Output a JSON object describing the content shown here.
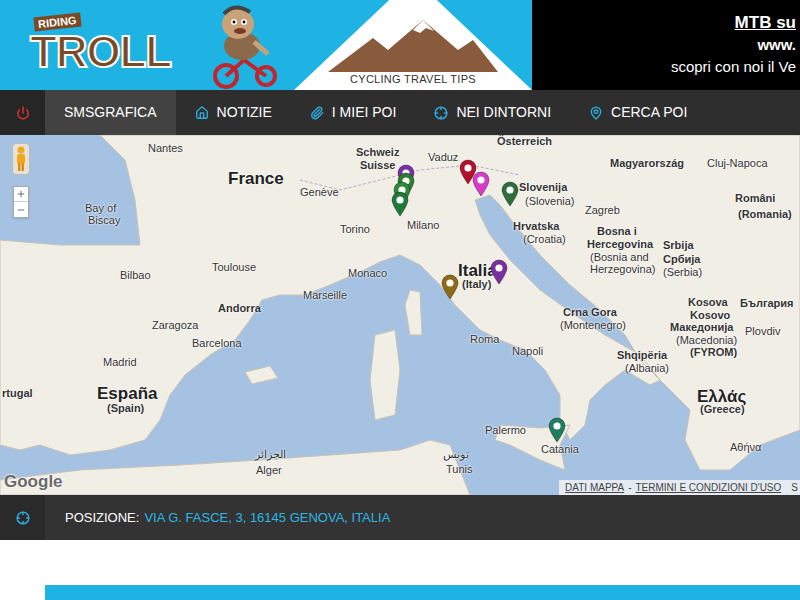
{
  "header": {
    "logo": {
      "top": "RIDING",
      "main": "TROLL"
    },
    "tagline": "CYCLING TRAVEL TIPS",
    "promo": [
      "MTB su",
      "www.",
      "scopri con noi il Ve"
    ]
  },
  "nav": {
    "items": [
      {
        "label": "",
        "selected": false
      },
      {
        "label": "SMSGRAFICA",
        "selected": true
      },
      {
        "label": "NOTIZIE",
        "selected": false
      },
      {
        "label": "I MIEI POI",
        "selected": false
      },
      {
        "label": "NEI DINTORNI",
        "selected": false
      },
      {
        "label": "CERCA POI",
        "selected": false
      }
    ]
  },
  "map": {
    "labels": [
      {
        "text": "France",
        "kind": "country"
      },
      {
        "text": "España",
        "kind": "country"
      },
      {
        "text": "(Spain)",
        "kind": "region"
      },
      {
        "text": "Italia",
        "kind": "country"
      },
      {
        "text": "(Italy)",
        "kind": "region"
      },
      {
        "text": "Bay of",
        "kind": "city"
      },
      {
        "text": "Biscay",
        "kind": "city"
      },
      {
        "text": "Nantes",
        "kind": "city"
      },
      {
        "text": "Genève",
        "kind": "city"
      },
      {
        "text": "Schweiz",
        "kind": "region"
      },
      {
        "text": "Suisse",
        "kind": "region"
      },
      {
        "text": "Vaduz",
        "kind": "city"
      },
      {
        "text": "Österreich",
        "kind": "region"
      },
      {
        "text": "Magyarország",
        "kind": "region"
      },
      {
        "text": "Cluj-Napoca",
        "kind": "city"
      },
      {
        "text": "Români",
        "kind": "region"
      },
      {
        "text": "(Romania)",
        "kind": "region"
      },
      {
        "text": "Slovenija",
        "kind": "region"
      },
      {
        "text": "(Slovenia)",
        "kind": "city"
      },
      {
        "text": "Zagreb",
        "kind": "city"
      },
      {
        "text": "Hrvatska",
        "kind": "region"
      },
      {
        "text": "(Croatia)",
        "kind": "city"
      },
      {
        "text": "Bosna i",
        "kind": "region"
      },
      {
        "text": "Hercegovina",
        "kind": "region"
      },
      {
        "text": "(Bosnia and",
        "kind": "city"
      },
      {
        "text": "Herzegovina)",
        "kind": "city"
      },
      {
        "text": "Srbija",
        "kind": "region"
      },
      {
        "text": "Србија",
        "kind": "region"
      },
      {
        "text": "(Serbia)",
        "kind": "city"
      },
      {
        "text": "Crna Gora",
        "kind": "region"
      },
      {
        "text": "(Montenegro)",
        "kind": "city"
      },
      {
        "text": "Kosova",
        "kind": "region"
      },
      {
        "text": "Македонија",
        "kind": "region"
      },
      {
        "text": "(Macedonia)",
        "kind": "city"
      },
      {
        "text": "(FYROM)",
        "kind": "region"
      },
      {
        "text": "Shqipëria",
        "kind": "region"
      },
      {
        "text": "(Albania)",
        "kind": "city"
      },
      {
        "text": "България",
        "kind": "region"
      },
      {
        "text": "Plovdiv",
        "kind": "city"
      },
      {
        "text": "Ελλάς",
        "kind": "country"
      },
      {
        "text": "(Greece)",
        "kind": "region"
      },
      {
        "text": "Αθήνα",
        "kind": "city"
      },
      {
        "text": "Milano",
        "kind": "city"
      },
      {
        "text": "Torino",
        "kind": "city"
      },
      {
        "text": "Monaco",
        "kind": "city"
      },
      {
        "text": "Marseille",
        "kind": "city"
      },
      {
        "text": "Toulouse",
        "kind": "city"
      },
      {
        "text": "Andorra",
        "kind": "region"
      },
      {
        "text": "Barcelona",
        "kind": "city"
      },
      {
        "text": "Zaragoza",
        "kind": "city"
      },
      {
        "text": "Bilbao",
        "kind": "city"
      },
      {
        "text": "Madrid",
        "kind": "city"
      },
      {
        "text": "Roma",
        "kind": "city"
      },
      {
        "text": "Napoli",
        "kind": "city"
      },
      {
        "text": "Palermo",
        "kind": "city"
      },
      {
        "text": "Catania",
        "kind": "city"
      },
      {
        "text": "تونس",
        "kind": "city"
      },
      {
        "text": "Tunis",
        "kind": "city"
      },
      {
        "text": "الجزائر",
        "kind": "city"
      },
      {
        "text": "Alger",
        "kind": "city"
      },
      {
        "text": "rtugal",
        "kind": "region"
      },
      {
        "text": "Kosovo",
        "kind": "region"
      }
    ],
    "pins": [
      {
        "color": "#7b2fa8"
      },
      {
        "color": "#2e7d32"
      },
      {
        "color": "#2e8b3a"
      },
      {
        "color": "#1f7a3a"
      },
      {
        "color": "#b3122e"
      },
      {
        "color": "#d63bc9"
      },
      {
        "color": "#2f6e3c"
      },
      {
        "color": "#7a2fa0"
      },
      {
        "color": "#8e6a18"
      },
      {
        "color": "#1f7d60"
      }
    ],
    "google": "Google",
    "attribution": [
      "DATI MAPPA",
      "-",
      "TERMINI E CONDIZIONI D'USO",
      "S"
    ]
  },
  "position": {
    "label": "POSIZIONE:",
    "value": "VIA G. FASCE, 3, 16145 GENOVA, ITALIA"
  }
}
